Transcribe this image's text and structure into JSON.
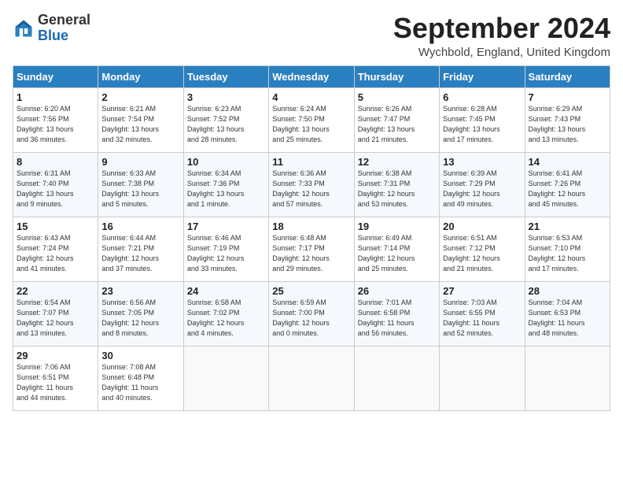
{
  "header": {
    "logo_general": "General",
    "logo_blue": "Blue",
    "month_year": "September 2024",
    "location": "Wychbold, England, United Kingdom"
  },
  "days_of_week": [
    "Sunday",
    "Monday",
    "Tuesday",
    "Wednesday",
    "Thursday",
    "Friday",
    "Saturday"
  ],
  "weeks": [
    [
      {
        "day": "1",
        "info": "Sunrise: 6:20 AM\nSunset: 7:56 PM\nDaylight: 13 hours\nand 36 minutes."
      },
      {
        "day": "2",
        "info": "Sunrise: 6:21 AM\nSunset: 7:54 PM\nDaylight: 13 hours\nand 32 minutes."
      },
      {
        "day": "3",
        "info": "Sunrise: 6:23 AM\nSunset: 7:52 PM\nDaylight: 13 hours\nand 28 minutes."
      },
      {
        "day": "4",
        "info": "Sunrise: 6:24 AM\nSunset: 7:50 PM\nDaylight: 13 hours\nand 25 minutes."
      },
      {
        "day": "5",
        "info": "Sunrise: 6:26 AM\nSunset: 7:47 PM\nDaylight: 13 hours\nand 21 minutes."
      },
      {
        "day": "6",
        "info": "Sunrise: 6:28 AM\nSunset: 7:45 PM\nDaylight: 13 hours\nand 17 minutes."
      },
      {
        "day": "7",
        "info": "Sunrise: 6:29 AM\nSunset: 7:43 PM\nDaylight: 13 hours\nand 13 minutes."
      }
    ],
    [
      {
        "day": "8",
        "info": "Sunrise: 6:31 AM\nSunset: 7:40 PM\nDaylight: 13 hours\nand 9 minutes."
      },
      {
        "day": "9",
        "info": "Sunrise: 6:33 AM\nSunset: 7:38 PM\nDaylight: 13 hours\nand 5 minutes."
      },
      {
        "day": "10",
        "info": "Sunrise: 6:34 AM\nSunset: 7:36 PM\nDaylight: 13 hours\nand 1 minute."
      },
      {
        "day": "11",
        "info": "Sunrise: 6:36 AM\nSunset: 7:33 PM\nDaylight: 12 hours\nand 57 minutes."
      },
      {
        "day": "12",
        "info": "Sunrise: 6:38 AM\nSunset: 7:31 PM\nDaylight: 12 hours\nand 53 minutes."
      },
      {
        "day": "13",
        "info": "Sunrise: 6:39 AM\nSunset: 7:29 PM\nDaylight: 12 hours\nand 49 minutes."
      },
      {
        "day": "14",
        "info": "Sunrise: 6:41 AM\nSunset: 7:26 PM\nDaylight: 12 hours\nand 45 minutes."
      }
    ],
    [
      {
        "day": "15",
        "info": "Sunrise: 6:43 AM\nSunset: 7:24 PM\nDaylight: 12 hours\nand 41 minutes."
      },
      {
        "day": "16",
        "info": "Sunrise: 6:44 AM\nSunset: 7:21 PM\nDaylight: 12 hours\nand 37 minutes."
      },
      {
        "day": "17",
        "info": "Sunrise: 6:46 AM\nSunset: 7:19 PM\nDaylight: 12 hours\nand 33 minutes."
      },
      {
        "day": "18",
        "info": "Sunrise: 6:48 AM\nSunset: 7:17 PM\nDaylight: 12 hours\nand 29 minutes."
      },
      {
        "day": "19",
        "info": "Sunrise: 6:49 AM\nSunset: 7:14 PM\nDaylight: 12 hours\nand 25 minutes."
      },
      {
        "day": "20",
        "info": "Sunrise: 6:51 AM\nSunset: 7:12 PM\nDaylight: 12 hours\nand 21 minutes."
      },
      {
        "day": "21",
        "info": "Sunrise: 6:53 AM\nSunset: 7:10 PM\nDaylight: 12 hours\nand 17 minutes."
      }
    ],
    [
      {
        "day": "22",
        "info": "Sunrise: 6:54 AM\nSunset: 7:07 PM\nDaylight: 12 hours\nand 13 minutes."
      },
      {
        "day": "23",
        "info": "Sunrise: 6:56 AM\nSunset: 7:05 PM\nDaylight: 12 hours\nand 8 minutes."
      },
      {
        "day": "24",
        "info": "Sunrise: 6:58 AM\nSunset: 7:02 PM\nDaylight: 12 hours\nand 4 minutes."
      },
      {
        "day": "25",
        "info": "Sunrise: 6:59 AM\nSunset: 7:00 PM\nDaylight: 12 hours\nand 0 minutes."
      },
      {
        "day": "26",
        "info": "Sunrise: 7:01 AM\nSunset: 6:58 PM\nDaylight: 11 hours\nand 56 minutes."
      },
      {
        "day": "27",
        "info": "Sunrise: 7:03 AM\nSunset: 6:55 PM\nDaylight: 11 hours\nand 52 minutes."
      },
      {
        "day": "28",
        "info": "Sunrise: 7:04 AM\nSunset: 6:53 PM\nDaylight: 11 hours\nand 48 minutes."
      }
    ],
    [
      {
        "day": "29",
        "info": "Sunrise: 7:06 AM\nSunset: 6:51 PM\nDaylight: 11 hours\nand 44 minutes."
      },
      {
        "day": "30",
        "info": "Sunrise: 7:08 AM\nSunset: 6:48 PM\nDaylight: 11 hours\nand 40 minutes."
      },
      {
        "day": "",
        "info": ""
      },
      {
        "day": "",
        "info": ""
      },
      {
        "day": "",
        "info": ""
      },
      {
        "day": "",
        "info": ""
      },
      {
        "day": "",
        "info": ""
      }
    ]
  ]
}
